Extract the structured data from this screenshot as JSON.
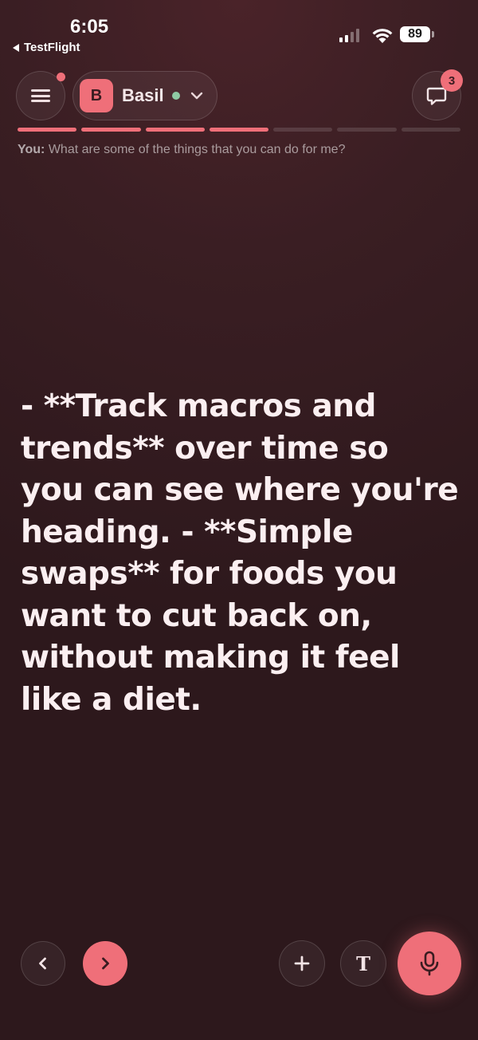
{
  "status_bar": {
    "time": "6:05",
    "back_app": "TestFlight",
    "battery": "89"
  },
  "header": {
    "persona": {
      "initial": "B",
      "name": "Basil"
    },
    "chat_badge_count": "3"
  },
  "progress": {
    "total_segments": 7,
    "filled_segments": 4
  },
  "conversation": {
    "user_label": "You:",
    "user_message": "What are some of the things that you can do for me?",
    "assistant_response": "- **Track macros and trends** over time so you can see where you're heading. - **Simple swaps** for foods you want to cut back on, without making it feel like a diet."
  },
  "toolbar": {
    "text_button_label": "T"
  },
  "colors": {
    "accent": "#ef6f79",
    "online": "#8fcaa4",
    "background": "#3a1e23"
  }
}
